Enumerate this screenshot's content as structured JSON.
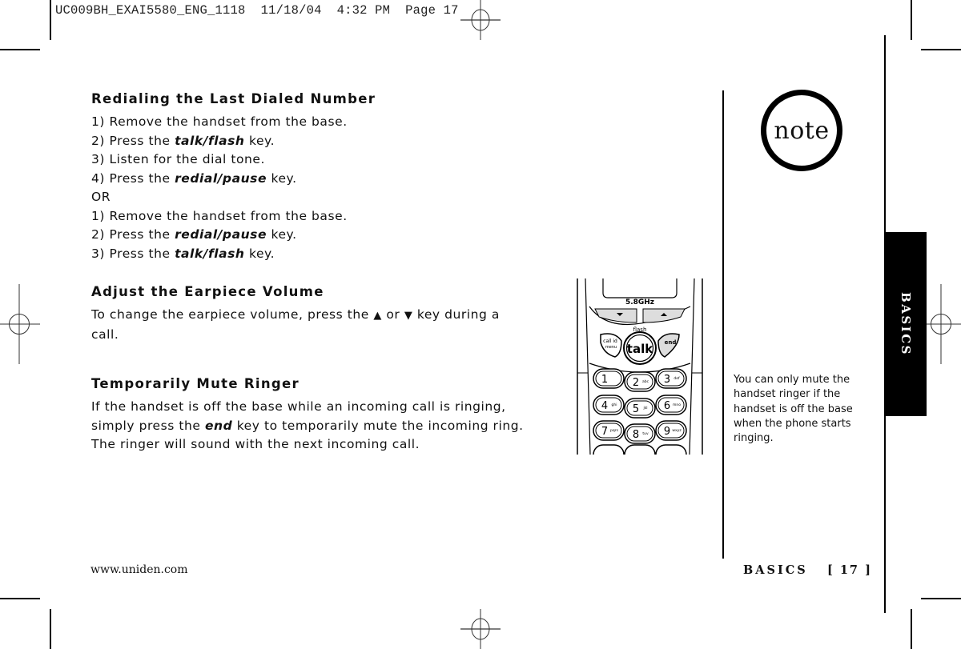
{
  "slug": {
    "file_name": "UC009BH_EXAI5580_ENG_1118",
    "date": "11/18/04",
    "time": "4:32 PM",
    "page_label": "Page 17"
  },
  "sections": {
    "redial": {
      "heading": "Redialing the Last Dialed Number",
      "steps_a": [
        {
          "pre": "1) Remove the handset from the base.",
          "key": "",
          "post": ""
        },
        {
          "pre": "2) Press the ",
          "key": "talk/flash",
          "post": " key."
        },
        {
          "pre": "3) Listen for the dial tone.",
          "key": "",
          "post": ""
        },
        {
          "pre": "4) Press the ",
          "key": "redial/pause",
          "post": " key."
        }
      ],
      "or_label": "OR",
      "steps_b": [
        {
          "pre": "1) Remove the handset from the base.",
          "key": "",
          "post": ""
        },
        {
          "pre": "2) Press the ",
          "key": "redial/pause",
          "post": " key."
        },
        {
          "pre": "3) Press the ",
          "key": "talk/flash",
          "post": " key."
        }
      ]
    },
    "volume": {
      "heading": "Adjust the Earpiece Volume",
      "text_1": "To change the earpiece volume, press the ",
      "up_symbol": "▲",
      "text_2": " or ",
      "down_symbol": "▼",
      "text_3": " key during a",
      "text_4": "call."
    },
    "mute": {
      "heading": "Temporarily Mute Ringer",
      "line_1": "If the handset is off the base while an incoming call is ringing,",
      "line_2_pre": "simply press the ",
      "line_2_key": "end",
      "line_2_post": " key to temporarily mute the incoming ring.",
      "line_3": "The ringer will sound with the next incoming call."
    }
  },
  "note": {
    "icon_label": "note",
    "text": "You can only mute the handset ringer if the handset is off the base when the phone starts ringing."
  },
  "side_tab": {
    "label": "BASICS"
  },
  "phone_illustration": {
    "band_label": "5.8GHz",
    "keys": {
      "flash": "flash",
      "call_id": "call id",
      "menu": "menu",
      "talk": "talk",
      "end": "end",
      "digits": [
        {
          "num": "1",
          "letters": ""
        },
        {
          "num": "2",
          "letters": "abc"
        },
        {
          "num": "3",
          "letters": "def"
        },
        {
          "num": "4",
          "letters": "ghi"
        },
        {
          "num": "5",
          "letters": "jkl"
        },
        {
          "num": "6",
          "letters": "mno"
        },
        {
          "num": "7",
          "letters": "pqrs"
        },
        {
          "num": "8",
          "letters": "tuv"
        },
        {
          "num": "9",
          "letters": "wxyz"
        }
      ]
    }
  },
  "footer": {
    "url": "www.uniden.com",
    "section": "BASICS",
    "page_number": "[ 17 ]"
  }
}
